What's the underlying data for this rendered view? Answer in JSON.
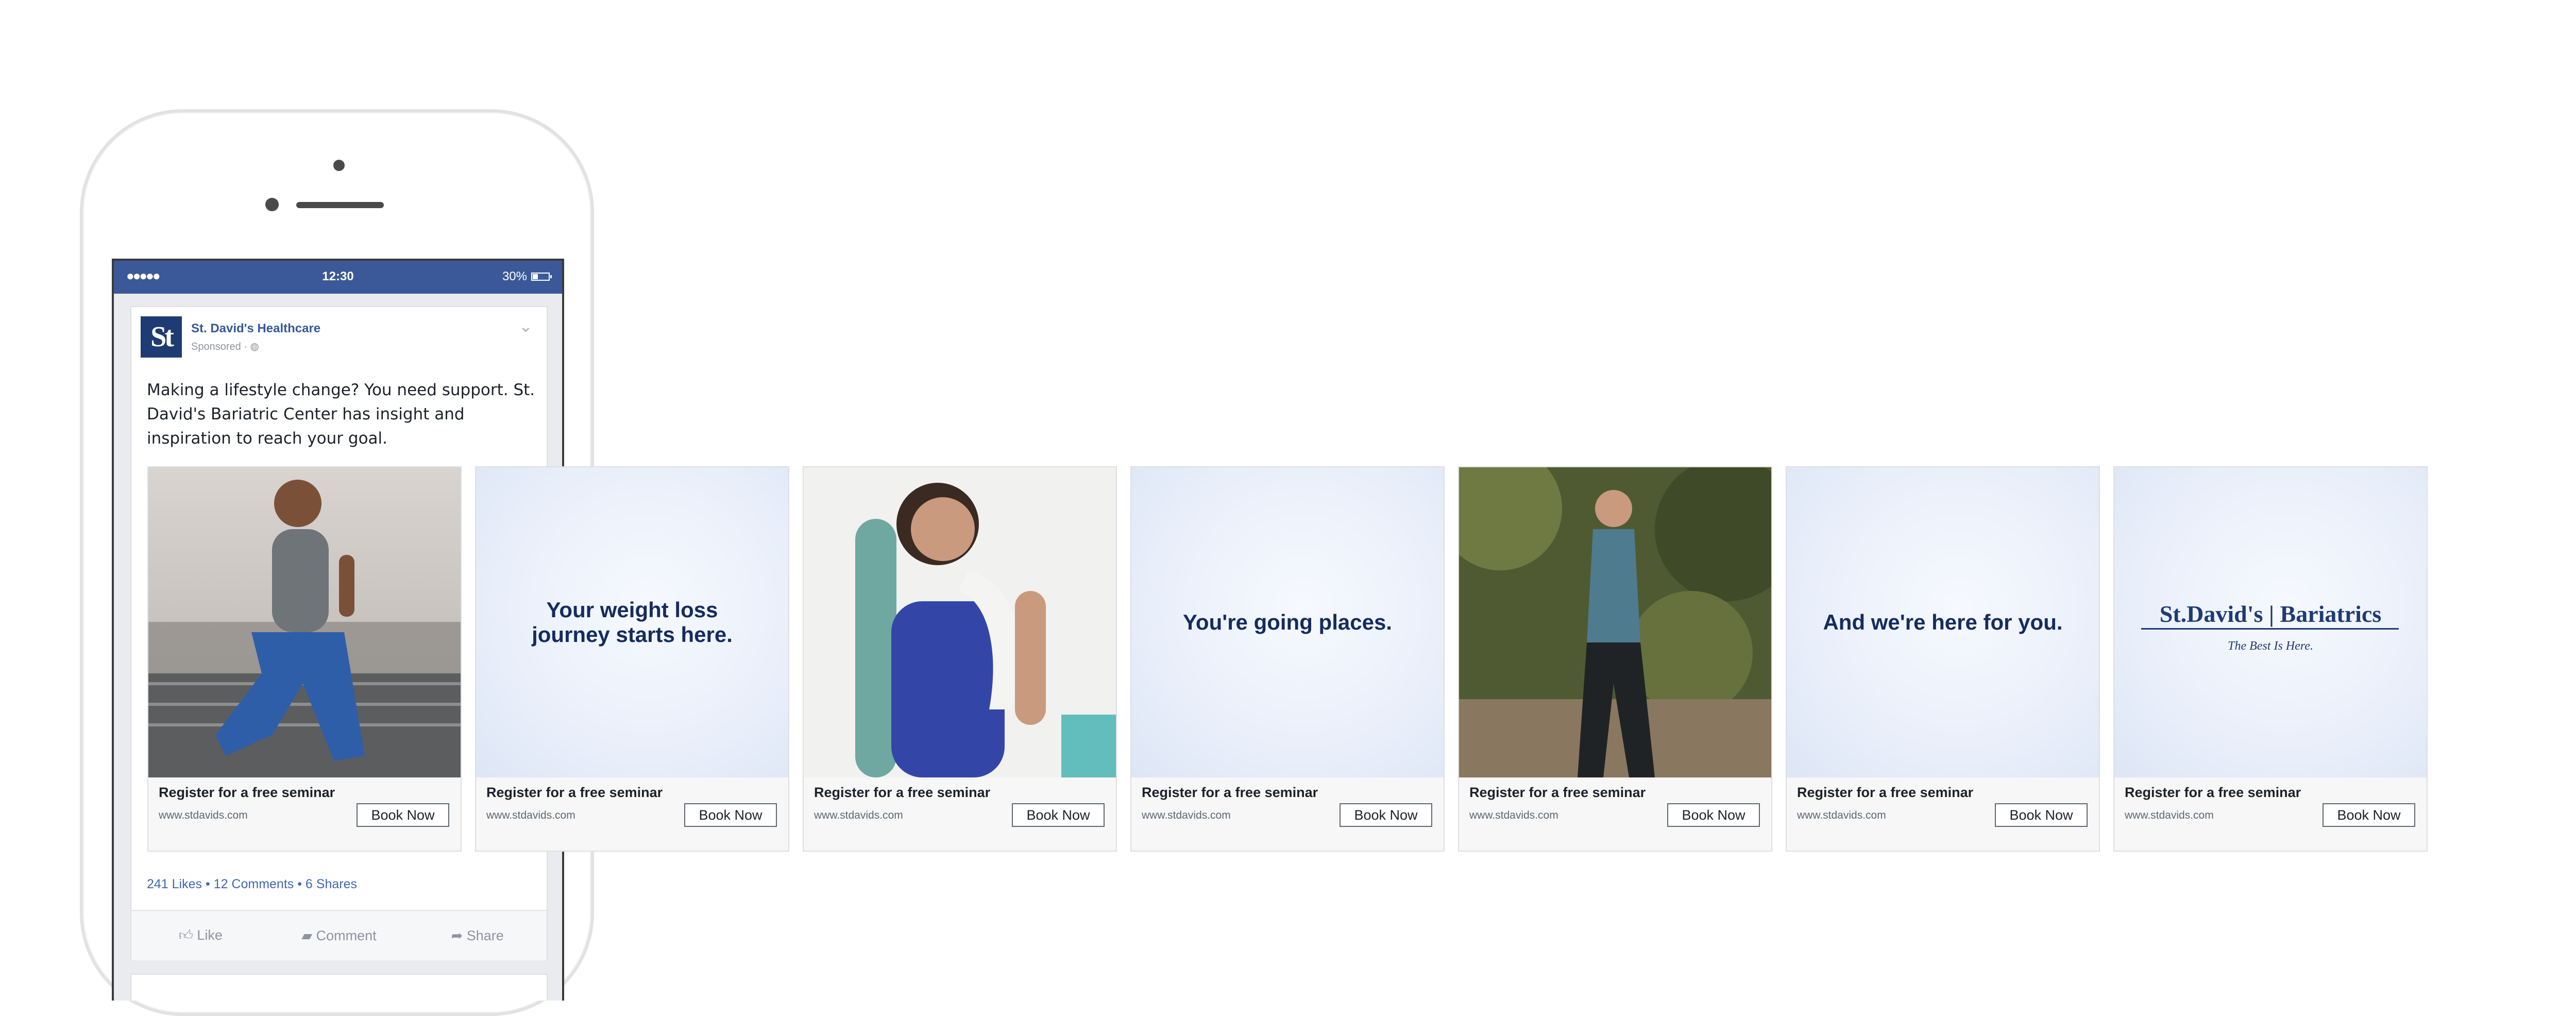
{
  "status_bar": {
    "signal": "●●●●●",
    "time": "12:30",
    "battery": "30%"
  },
  "post": {
    "logo_text": "St",
    "page_name": "St. David's Healthcare",
    "sponsored": "Sponsored · ◍",
    "message": "Making a lifestyle change? You need support. St. David's Bariatric Center has insight and inspiration to reach your goal.",
    "social": "241 Likes • 12 Comments • 6 Shares",
    "actions": {
      "like": "Like",
      "comment": "Comment",
      "share": "Share"
    }
  },
  "cards": [
    {
      "type": "photo",
      "image": "man-running",
      "title": "Register for a free seminar",
      "url": "www.stdavids.com",
      "cta": "Book Now"
    },
    {
      "type": "text",
      "headline_l1": "Your weight loss",
      "headline_l2": "journey starts here.",
      "title": "Register for a free seminar",
      "url": "www.stdavids.com",
      "cta": "Book Now"
    },
    {
      "type": "photo",
      "image": "woman-yoga-mat",
      "title": "Register for a free seminar",
      "url": "www.stdavids.com",
      "cta": "Book Now"
    },
    {
      "type": "text",
      "headline_l1": "You're going places.",
      "headline_l2": "",
      "title": "Register for a free seminar",
      "url": "www.stdavids.com",
      "cta": "Book Now"
    },
    {
      "type": "photo",
      "image": "woman-jogging-trail",
      "title": "Register for a free seminar",
      "url": "www.stdavids.com",
      "cta": "Book Now"
    },
    {
      "type": "text",
      "headline_l1": "And we're here for you.",
      "headline_l2": "",
      "title": "Register for a free seminar",
      "url": "www.stdavids.com",
      "cta": "Book Now"
    },
    {
      "type": "brand",
      "brand_name": "St.David's | Bariatrics",
      "tagline": "The Best Is Here.",
      "title": "Register for a free seminar",
      "url": "www.stdavids.com",
      "cta": "Book Now"
    }
  ],
  "colors": {
    "facebook_blue": "#3b5998",
    "brand_navy": "#1f3b73",
    "link_blue": "#4267b2"
  }
}
